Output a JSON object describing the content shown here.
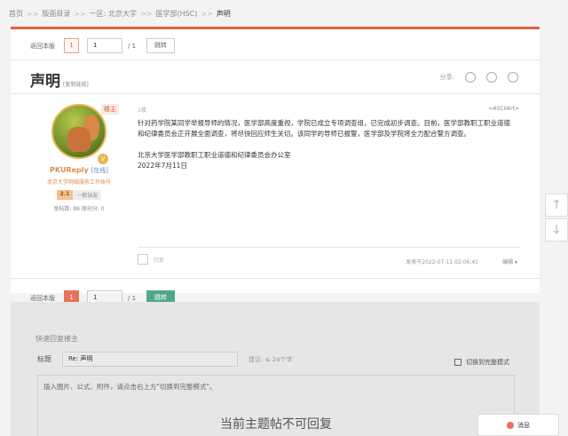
{
  "breadcrumb": [
    "首页",
    "版面目录",
    "一区: 北京大学",
    "医学部(HSC)",
    "声明"
  ],
  "breadcrumb_sep": ">>",
  "pager": {
    "back": "返回本版",
    "current_page": "1",
    "input_value": "1",
    "total": "/ 1",
    "jump": "跳转"
  },
  "post_title": "声明",
  "copy_link": "[复制链接]",
  "share_label": "分享:",
  "author": {
    "role": "楼主",
    "name": "PKUReply",
    "online": "[在线]",
    "subtitle": "北京大学网络服务工作账号",
    "level_num": "2.1",
    "level_name": "一般站友",
    "stats": "发帖数: 88   原创分: 0"
  },
  "post": {
    "floor": "1楼",
    "ascii": "<ASCIIArt>",
    "paragraph1": "针对药学院某同学举报导师的情况，医学部高度重视，学院已成立专项调查组，已完成初步调查。目前，医学部教职工职业道德和纪律委员会正开展全面调查，将尽快回应师生关切。该同学的导师已报警，医学部及学院将全力配合警方调查。",
    "signature": "北京大学医学部教职工职业道德和纪律委员会办公室",
    "date": "2022年7月11日"
  },
  "footer": {
    "reply": "回复",
    "time": "发表于2022-07-11 02:06:41",
    "edit": "编辑 ▾"
  },
  "quick_reply": {
    "title": "快速回复楼主",
    "subject_label": "标题",
    "subject_value": "Re: 声明",
    "hint": "建议: ≤ 24个字",
    "full_mode": "切换到完整模式",
    "placeholder": "插入图片、公式、附件，请点击右上方\"切换到完整模式\"。",
    "locked": "当前主题帖不可回复"
  },
  "messages": "消息",
  "side": {
    "up": "↑",
    "down": "↓"
  }
}
